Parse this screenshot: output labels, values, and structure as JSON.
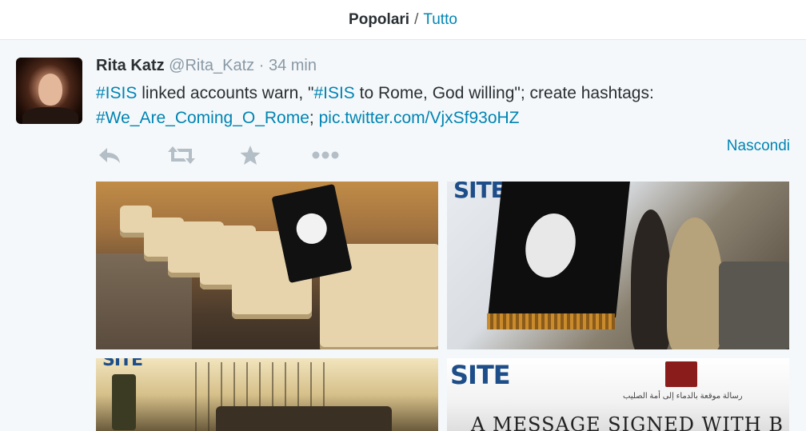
{
  "filter": {
    "popular_label": "Popolari",
    "separator": "/",
    "all_label": "Tutto"
  },
  "tweet": {
    "name": "Rita Katz",
    "handle": "@Rita_Katz",
    "dot": "·",
    "time": "34 min",
    "text": {
      "hashtag1": "#ISIS",
      "t1": " linked accounts warn, \"",
      "hashtag2": "#ISIS",
      "t2": " to Rome, God willing\"; create hashtags: ",
      "hashtag3": "#We_Are_Coming_O_Rome",
      "t3": "; ",
      "link": "pic.twitter.com/VjxSf93oHZ"
    },
    "hide_label": "Nascondi",
    "actions": [
      "reply-icon",
      "retweet-icon",
      "favorite-icon",
      "more-icon"
    ]
  },
  "media": {
    "watermark": "SITE",
    "caption": "A MESSAGE SIGNED WITH B",
    "arabic_text": "رسالة موقعة بالدماء إلى أمة الصليب"
  },
  "colors": {
    "link": "#0084b4",
    "muted": "#8899a6",
    "icon": "#b4bec6",
    "background": "#f5f8fa"
  }
}
